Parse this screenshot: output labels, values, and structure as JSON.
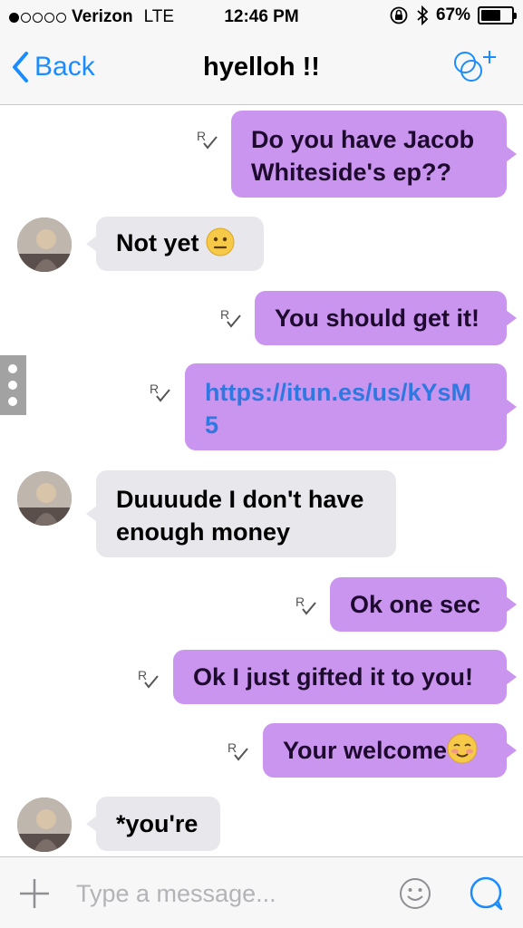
{
  "status_bar": {
    "carrier": "Verizon",
    "network": "LTE",
    "time": "12:46 PM",
    "battery_percent": "67%",
    "battery_level": 0.67,
    "signal_bars": 1,
    "icons": [
      "rotation-lock-icon",
      "bluetooth-icon",
      "battery-icon"
    ]
  },
  "nav": {
    "back_label": "Back",
    "title": "hyelloh !!",
    "action_icon": "add-participant-icon"
  },
  "messages": [
    {
      "direction": "out",
      "lines": [
        "Do you have Jacob",
        "Whiteside's ep??"
      ],
      "status_icon": "read-receipt-icon"
    },
    {
      "direction": "in",
      "lines": [
        "Not yet"
      ],
      "emoji": "neutral-face-emoji"
    },
    {
      "direction": "out",
      "lines": [
        "You should get it!"
      ],
      "status_icon": "read-receipt-icon"
    },
    {
      "direction": "out",
      "lines": [
        "https://itun.es/us/kYsM",
        "5"
      ],
      "is_link": true,
      "status_icon": "read-receipt-icon"
    },
    {
      "direction": "in",
      "lines": [
        "Duuuude I don't have",
        "enough money"
      ]
    },
    {
      "direction": "out",
      "lines": [
        "Ok one sec"
      ],
      "status_icon": "read-receipt-icon"
    },
    {
      "direction": "out",
      "lines": [
        "Ok I just gifted it to you!"
      ],
      "status_icon": "read-receipt-icon"
    },
    {
      "direction": "out",
      "lines": [
        "Your welcome"
      ],
      "emoji": "smiling-blush-emoji",
      "status_icon": "read-receipt-icon"
    },
    {
      "direction": "in",
      "lines": [
        "*you're"
      ]
    }
  ],
  "input": {
    "placeholder": "Type a message...",
    "left_icon": "plus-icon",
    "emoji_icon": "smiley-icon",
    "send_icon": "chat-bubble-icon"
  },
  "colors": {
    "accent": "#1a8cff",
    "outgoing_bubble": "#ca95ef",
    "incoming_bubble": "#e8e7ec",
    "link": "#2f78e0",
    "bar_background": "#f7f7f7"
  }
}
